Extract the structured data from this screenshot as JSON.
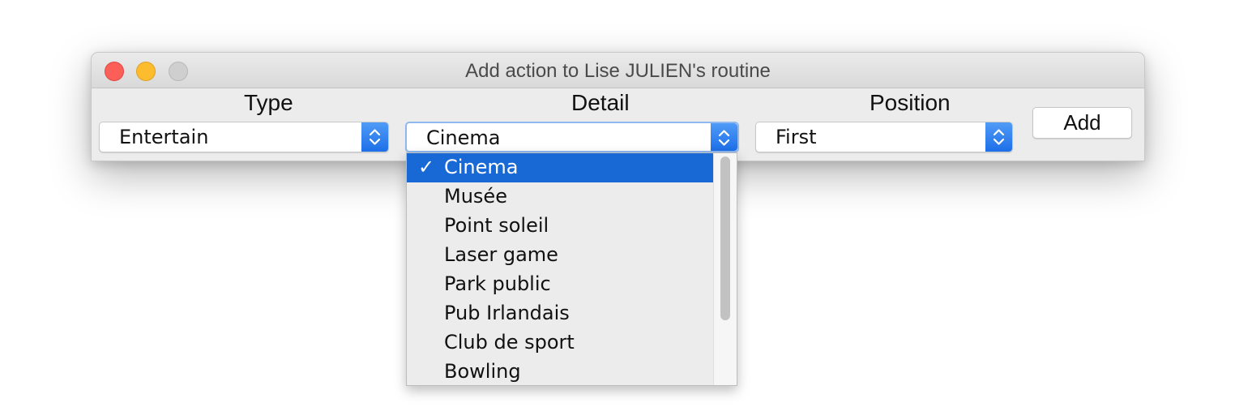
{
  "window": {
    "title": "Add action to Lise JULIEN's routine"
  },
  "form": {
    "type": {
      "label": "Type",
      "value": "Entertain"
    },
    "detail": {
      "label": "Detail",
      "value": "Cinema"
    },
    "position": {
      "label": "Position",
      "value": "First"
    },
    "add_label": "Add"
  },
  "dropdown": {
    "check": "✓",
    "items": [
      "Cinema",
      "Musée",
      "Point soleil",
      "Laser game",
      "Park public",
      "Pub Irlandais",
      "Club de sport",
      "Bowling"
    ],
    "selected_index": 0
  },
  "colors": {
    "accent": "#1868d6",
    "close": "#fc5f57",
    "minimize": "#fdbc2e"
  }
}
